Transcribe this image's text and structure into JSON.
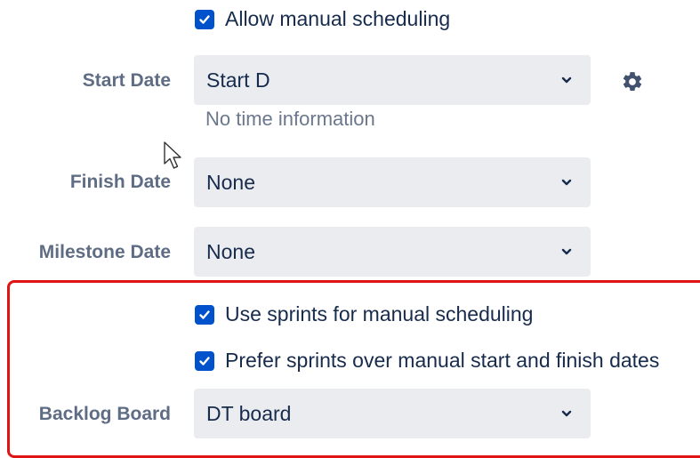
{
  "manual_scheduling": {
    "label": "Allow manual scheduling",
    "checked": true
  },
  "start_date": {
    "label": "Start Date",
    "value": "Start D",
    "hint": "No time information",
    "settings_icon": "gear-icon"
  },
  "finish_date": {
    "label": "Finish Date",
    "value": "None"
  },
  "milestone_date": {
    "label": "Milestone Date",
    "value": "None"
  },
  "use_sprints": {
    "label": "Use sprints for manual scheduling",
    "checked": true
  },
  "prefer_sprints": {
    "label": "Prefer sprints over manual start and finish dates",
    "checked": true
  },
  "backlog_board": {
    "label": "Backlog Board",
    "value": "DT board"
  },
  "colors": {
    "checkbox": "#0052cc",
    "select_background": "#ebecf0",
    "label": "#5e6c84",
    "highlight": "#e01414"
  }
}
